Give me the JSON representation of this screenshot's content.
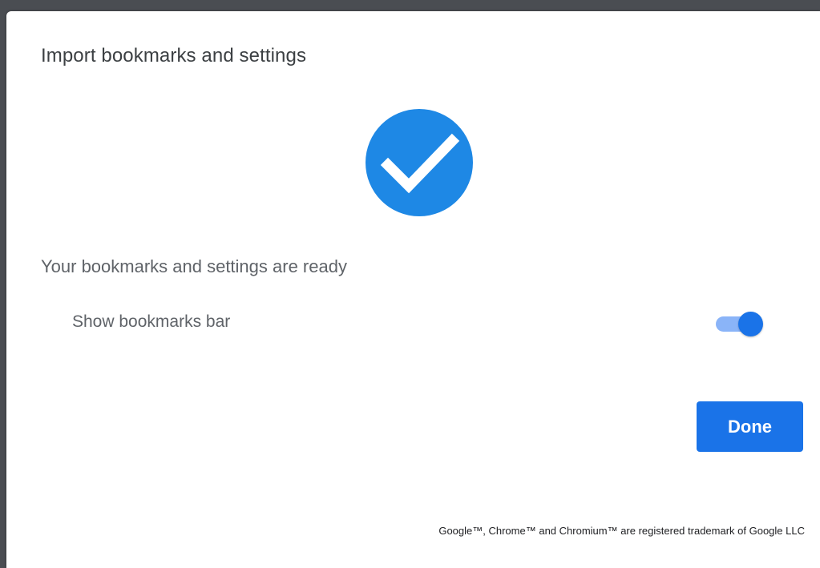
{
  "dialog": {
    "title": "Import bookmarks and settings",
    "status_icon": "check-circle-icon",
    "status_text": "Your bookmarks and settings are ready",
    "show_bookmarks_bar": {
      "label": "Show bookmarks bar",
      "enabled": true
    },
    "done_label": "Done",
    "footer": "Google™, Chrome™ and Chromium™ are registered trademark of Google LLC"
  },
  "colors": {
    "accent": "#1a73e8",
    "check_circle": "#1e88e5",
    "toggle_track": "#8ab4f8",
    "title_text": "#3c4043",
    "body_text": "#5f6368"
  }
}
